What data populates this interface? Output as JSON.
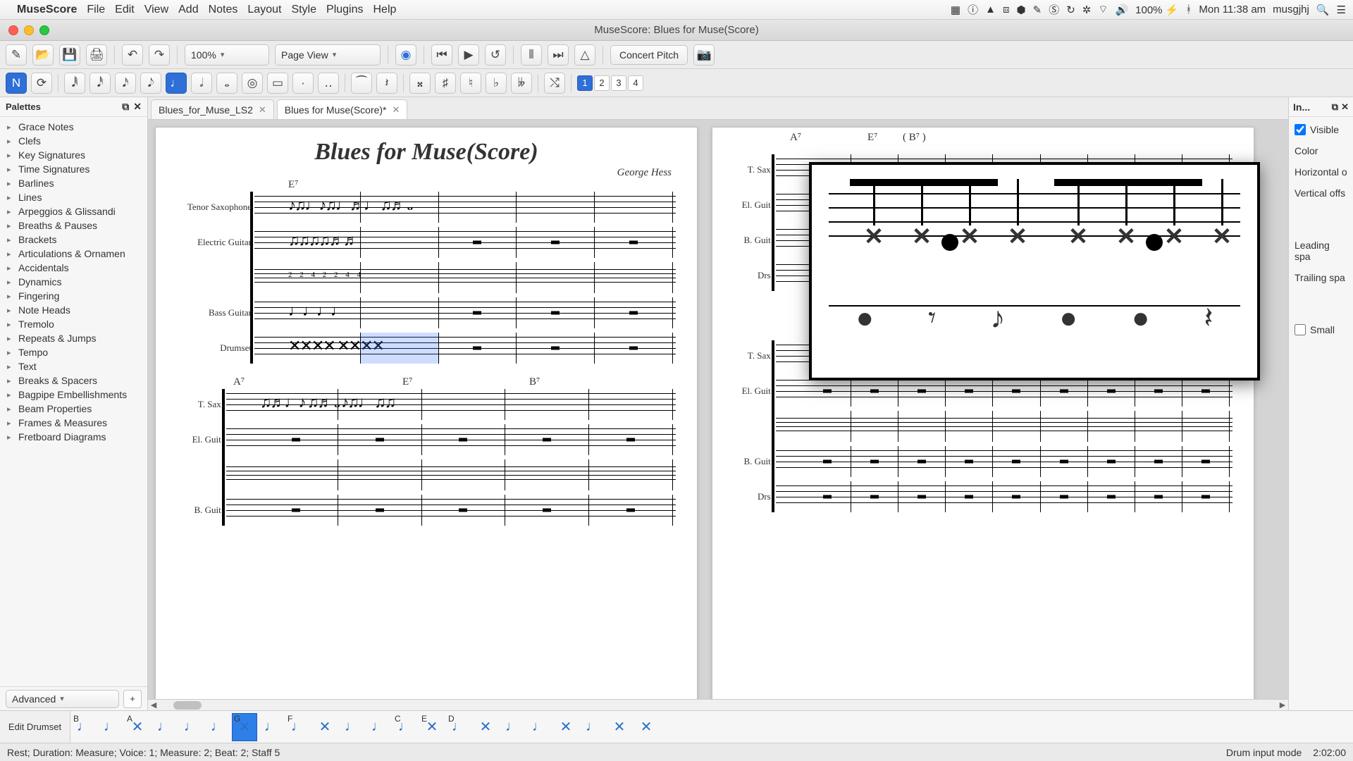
{
  "menubar": {
    "appname": "MuseScore",
    "items": [
      "File",
      "Edit",
      "View",
      "Add",
      "Notes",
      "Layout",
      "Style",
      "Plugins",
      "Help"
    ],
    "right_icons": [
      "▣",
      "ⓘ",
      "☁",
      "⌘",
      "⬢",
      "⬣",
      "◈",
      "§",
      "↻",
      "✲",
      "�까",
      "🔊"
    ],
    "battery": "100% ⚡",
    "bt": "ᚼ",
    "clock": "Mon 11:38 am",
    "user": "musgjhj",
    "search_icon": "🔍",
    "menu_icon": "☰"
  },
  "titlebar": {
    "title": "MuseScore: Blues for Muse(Score)"
  },
  "toolbar1": {
    "zoom": "100%",
    "viewmode": "Page View",
    "concert_pitch": "Concert Pitch"
  },
  "voices": [
    "1",
    "2",
    "3",
    "4"
  ],
  "tabs": [
    {
      "label": "Blues_for_Muse_LS2",
      "active": false
    },
    {
      "label": "Blues for Muse(Score)*",
      "active": true
    }
  ],
  "palette": {
    "title": "Palettes",
    "items": [
      "Grace Notes",
      "Clefs",
      "Key Signatures",
      "Time Signatures",
      "Barlines",
      "Lines",
      "Arpeggios & Glissandi",
      "Breaths & Pauses",
      "Brackets",
      "Articulations & Ornamen",
      "Accidentals",
      "Dynamics",
      "Fingering",
      "Note Heads",
      "Tremolo",
      "Repeats & Jumps",
      "Tempo",
      "Text",
      "Breaks & Spacers",
      "Bagpipe Embellishments",
      "Beam Properties",
      "Frames & Measures",
      "Fretboard Diagrams"
    ],
    "workspace": "Advanced"
  },
  "score": {
    "title": "Blues for Muse(Score)",
    "composer": "George Hess",
    "left_systems": [
      {
        "chords": [
          "E⁷"
        ],
        "staves": [
          {
            "label": "Tenor Saxophone",
            "content": "notes"
          },
          {
            "label": "Electric Guitar",
            "content": "notes"
          },
          {
            "label": "",
            "content": "tab"
          },
          {
            "label": "Bass Guitar",
            "content": "notes"
          },
          {
            "label": "Drumset",
            "content": "perc",
            "selected_measure": 2
          }
        ]
      },
      {
        "chords": [
          "A⁷",
          "",
          "E⁷",
          "",
          "B⁷"
        ],
        "staves": [
          {
            "label": "T. Sax.",
            "content": "notes"
          },
          {
            "label": "El. Guit.",
            "content": "rest"
          },
          {
            "label": "",
            "content": "tab"
          },
          {
            "label": "B. Guit.",
            "content": "rest"
          }
        ]
      }
    ],
    "right_chords": [
      "A⁷",
      "E⁷",
      "( B⁷ )"
    ],
    "right_labels_top": [
      "T. Sax.",
      "El. Guit.",
      "B. Guit.",
      "Drs."
    ],
    "right_labels_mid": [
      "T. Sax.",
      "El. Guit.",
      "B. Guit.",
      "Drs."
    ]
  },
  "inspector": {
    "title": "In...",
    "visible": "Visible",
    "color": "Color",
    "hoff": "Horizontal o",
    "voff": "Vertical offs",
    "lead": "Leading spa",
    "trail": "Trailing spa",
    "small": "Small"
  },
  "drumbar": {
    "edit": "Edit Drumset",
    "slots": [
      {
        "letter": "B",
        "head": "♩",
        "sel": false
      },
      {
        "letter": "",
        "head": "♩",
        "sel": false
      },
      {
        "letter": "A",
        "head": "✕",
        "sel": false
      },
      {
        "letter": "",
        "head": "♩",
        "sel": false
      },
      {
        "letter": "",
        "head": "♩",
        "sel": false
      },
      {
        "letter": "",
        "head": "♩",
        "sel": false
      },
      {
        "letter": "G",
        "head": "✕",
        "sel": true
      },
      {
        "letter": "",
        "head": "♩",
        "sel": false
      },
      {
        "letter": "F",
        "head": "♩",
        "sel": false
      },
      {
        "letter": "",
        "head": "✕",
        "sel": false
      },
      {
        "letter": "",
        "head": "♩",
        "sel": false
      },
      {
        "letter": "",
        "head": "♩",
        "sel": false
      },
      {
        "letter": "C",
        "head": "♩",
        "sel": false
      },
      {
        "letter": "E",
        "head": "✕",
        "sel": false
      },
      {
        "letter": "D",
        "head": "♩",
        "sel": false
      },
      {
        "letter": "",
        "head": "✕",
        "sel": false
      },
      {
        "letter": "",
        "head": "♩",
        "sel": false
      },
      {
        "letter": "",
        "head": "♩",
        "sel": false
      },
      {
        "letter": "",
        "head": "✕",
        "sel": false
      },
      {
        "letter": "",
        "head": "♩",
        "sel": false
      },
      {
        "letter": "",
        "head": "✕",
        "sel": false
      },
      {
        "letter": "",
        "head": "✕",
        "sel": false
      }
    ]
  },
  "status": {
    "left": "Rest; Duration: Measure; Voice: 1;   Measure: 2; Beat: 2; Staff 5",
    "mode": "Drum input mode",
    "time": "2:02:00"
  }
}
